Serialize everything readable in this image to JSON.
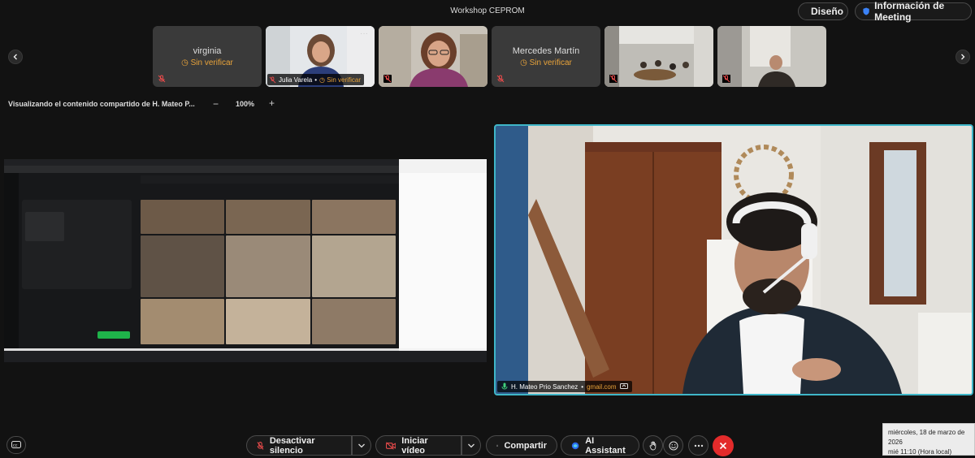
{
  "header": {
    "title": "Workshop CEPROM",
    "design_label": "Diseño",
    "meeting_info_label": "Información de Meeting"
  },
  "participants": [
    {
      "name": "virginia",
      "status": "Sin verificar",
      "has_video": false,
      "muted": true
    },
    {
      "name": "Julia Varela",
      "status": "Sin verificar",
      "has_video": true,
      "muted": true
    },
    {
      "name": "",
      "status": "",
      "has_video": true,
      "muted": true
    },
    {
      "name": "Mercedes Martín",
      "status": "Sin verificar",
      "has_video": false,
      "muted": true
    },
    {
      "name": "",
      "status": "",
      "has_video": true,
      "muted": true
    },
    {
      "name": "",
      "status": "",
      "has_video": true,
      "muted": true
    }
  ],
  "share": {
    "viewing_label": "Visualizando el contenido compartido de H. Mateo P...",
    "zoom_minus": "−",
    "zoom_value": "100%",
    "zoom_plus": "+"
  },
  "speaker": {
    "name": "H. Mateo Prio Sanchez",
    "separator": "•",
    "email": "gmail.com"
  },
  "controls": {
    "mute_label": "Desactivar silencio",
    "video_label": "Iniciar vídeo",
    "share_label": "Compartir",
    "ai_label": "AI Assistant"
  },
  "clock": {
    "date": "miércoles, 18 de marzo de 2026",
    "time": "mié 11:10 (Hora local)"
  },
  "colors": {
    "accent_speaker_border": "#3fb6c8",
    "status_unverified": "#e8a33a",
    "leave_button": "#e32b2b",
    "generate_button": "#1fb34a"
  }
}
